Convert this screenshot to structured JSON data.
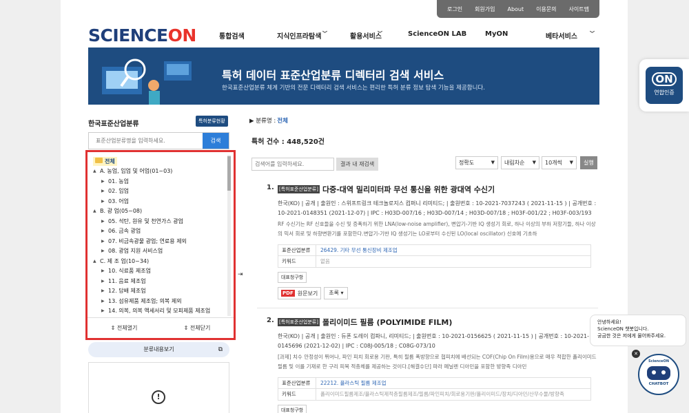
{
  "topbar": [
    "로그인",
    "회원가입",
    "About",
    "이용문의",
    "사이트맵"
  ],
  "logo": {
    "sci": "SCIENCE",
    "on": "ON"
  },
  "nav": [
    "통합검색",
    "지식인프라탐색",
    "활용서비스",
    "ScienceON LAB",
    "MyON",
    "베타서비스"
  ],
  "banner": {
    "title": "특허 데이터 표준산업분류 디렉터리 검색 서비스",
    "desc": "한국표준산업분류 체계 기반의 전문 디렉터리 검색 서비스는 편리한 특허 분류 정보 탐색 기능을 제공합니다."
  },
  "side": {
    "mark": "ON",
    "label": "연합인증"
  },
  "left": {
    "title": "한국표준산업분류",
    "btn": "특허분류현황",
    "search_placeholder": "표준산업분류명을 입력하세요.",
    "search_btn": "검색",
    "root": "전체",
    "tree": [
      {
        "lv": "l1",
        "t": "▲",
        "label": "A. 농업, 임업 및 어업(01~03)"
      },
      {
        "lv": "l2",
        "t": "▶",
        "label": "01. 농업"
      },
      {
        "lv": "l2",
        "t": "▶",
        "label": "02. 임업"
      },
      {
        "lv": "l2",
        "t": "▶",
        "label": "03. 어업"
      },
      {
        "lv": "l1",
        "t": "▲",
        "label": "B. 광 업(05~08)"
      },
      {
        "lv": "l2",
        "t": "▶",
        "label": "05. 석탄, 원유 및 천연가스 광업"
      },
      {
        "lv": "l2",
        "t": "▶",
        "label": "06. 금속 광업"
      },
      {
        "lv": "l2",
        "t": "▶",
        "label": "07. 비금속광물 광업; 연료용 제외"
      },
      {
        "lv": "l2",
        "t": "▶",
        "label": "08. 광업 지원 서비스업"
      },
      {
        "lv": "l1",
        "t": "▲",
        "label": "C. 제 조 업(10~34)"
      },
      {
        "lv": "l2",
        "t": "▶",
        "label": "10. 식료품 제조업"
      },
      {
        "lv": "l2",
        "t": "▶",
        "label": "11. 음료 제조업"
      },
      {
        "lv": "l2",
        "t": "▶",
        "label": "12. 담배 제조업"
      },
      {
        "lv": "l2",
        "t": "▶",
        "label": "13. 섬유제품 제조업; 의복 제외"
      },
      {
        "lv": "l2",
        "t": "▶",
        "label": "14. 의복, 의복 액세서리 및 모피제품 제조업"
      }
    ],
    "expand": "전체열기",
    "collapse": "전체닫기",
    "view_btn": "분류내용보기"
  },
  "main": {
    "crumb_label": "▶ 분류명 :",
    "crumb_value": "전체",
    "count": "특허 건수 : 448,520건",
    "filter_placeholder": "검색어를 입력하세요.",
    "refine_btn": "결과 내 재검색",
    "sort": "정확도",
    "order": "내림차순",
    "per_page": "10개씩",
    "run": "실행"
  },
  "results": [
    {
      "num": "1.",
      "badge": "[특허표준산업분류]",
      "title": "다중-대역 밀리미터파 무선 통신을 위한 광대역 수신기",
      "meta": "한국(KO) | 공개 | 출원인 : 스위프트링크 테크놀로지스 컴퍼니 리미티드; | 출원번호 : 10-2021-7037243 ( 2021-11-15 ) | 공개번호 : 10-2021-0148351 (2021-12-07) | IPC : H03D-007/16 ; H03D-007/14 ; H03D-007/18 ; H03F-001/22 ; H03F-003/193",
      "abs": "RF 수신기는 RF 신호들을 수신 및 증폭하기 위한 LNA(low-noise amplifier), 변압기-기반 IQ 생성기 회로, 하나 이상의 부하 저항기들, 하나 이상의 믹서 회로 및 하향변환기를 포함한다.변압기-기반 IQ 생성기는 LO로부터 수신된 LO(local oscillator) 신호에 기초하",
      "kv_class_label": "표준산업분류",
      "kv_class_value": "26429. 기타 무선 통신장비 제조업",
      "kv_key_label": "키워드",
      "kv_key_value": "없음",
      "tag": "대표청구항",
      "pdf": "PDF",
      "pdf_label": "원문보기",
      "abs_btn": "초록"
    },
    {
      "num": "2.",
      "badge": "[특허표준산업분류]",
      "title": "폴리이미드 필름 (POLYIMIDE FILM)",
      "meta": "한국(KO) | 공개 | 출원인 : 듀폰 도레이 컴파니, 리미티드; | 출원번호 : 10-2021-0156625 ( 2021-11-15 ) | 공개번호 : 10-2021-0145696 (2021-12-02) | IPC : C08J-005/18 ; C08G-073/10",
      "abs": "[과제] 치수 안정성이 뛰어나, 파인 피치 회로용 기판, 특히 필름 폭방향으로 협피치에 배선되는 COF(Chip On Film)용으로 매우 적합한 폴리이미드 필름 및 이를 기재로 한 구리 피복 적층체를 제공하는 것이다.[해결수단] 파라 페닐렌 디아민을 포함한 방향족 디아민",
      "kv_class_label": "표준산업분류",
      "kv_class_value": "22212. 플라스틱 필름 제조업",
      "kv_key_label": "키워드",
      "kv_key_value": "폴리이미드필름제조/플라스틱제적층필름제조/필름/파인피치/회로용기판/폴리이미드/장치/디아민/산무수물/방향족",
      "tag": "대표청구항"
    }
  ],
  "chat": {
    "line1": "안녕하세요!",
    "line2": "ScienceON 챗봇입니다.",
    "line3": "궁금한 것은 저에게 물어봐주세요.",
    "bot_top": "ScienceON",
    "bot_label": "CHATBOT"
  },
  "colors": {
    "brand": "#1e4c80",
    "accent": "#e9332b",
    "highlight": "#e03131"
  }
}
